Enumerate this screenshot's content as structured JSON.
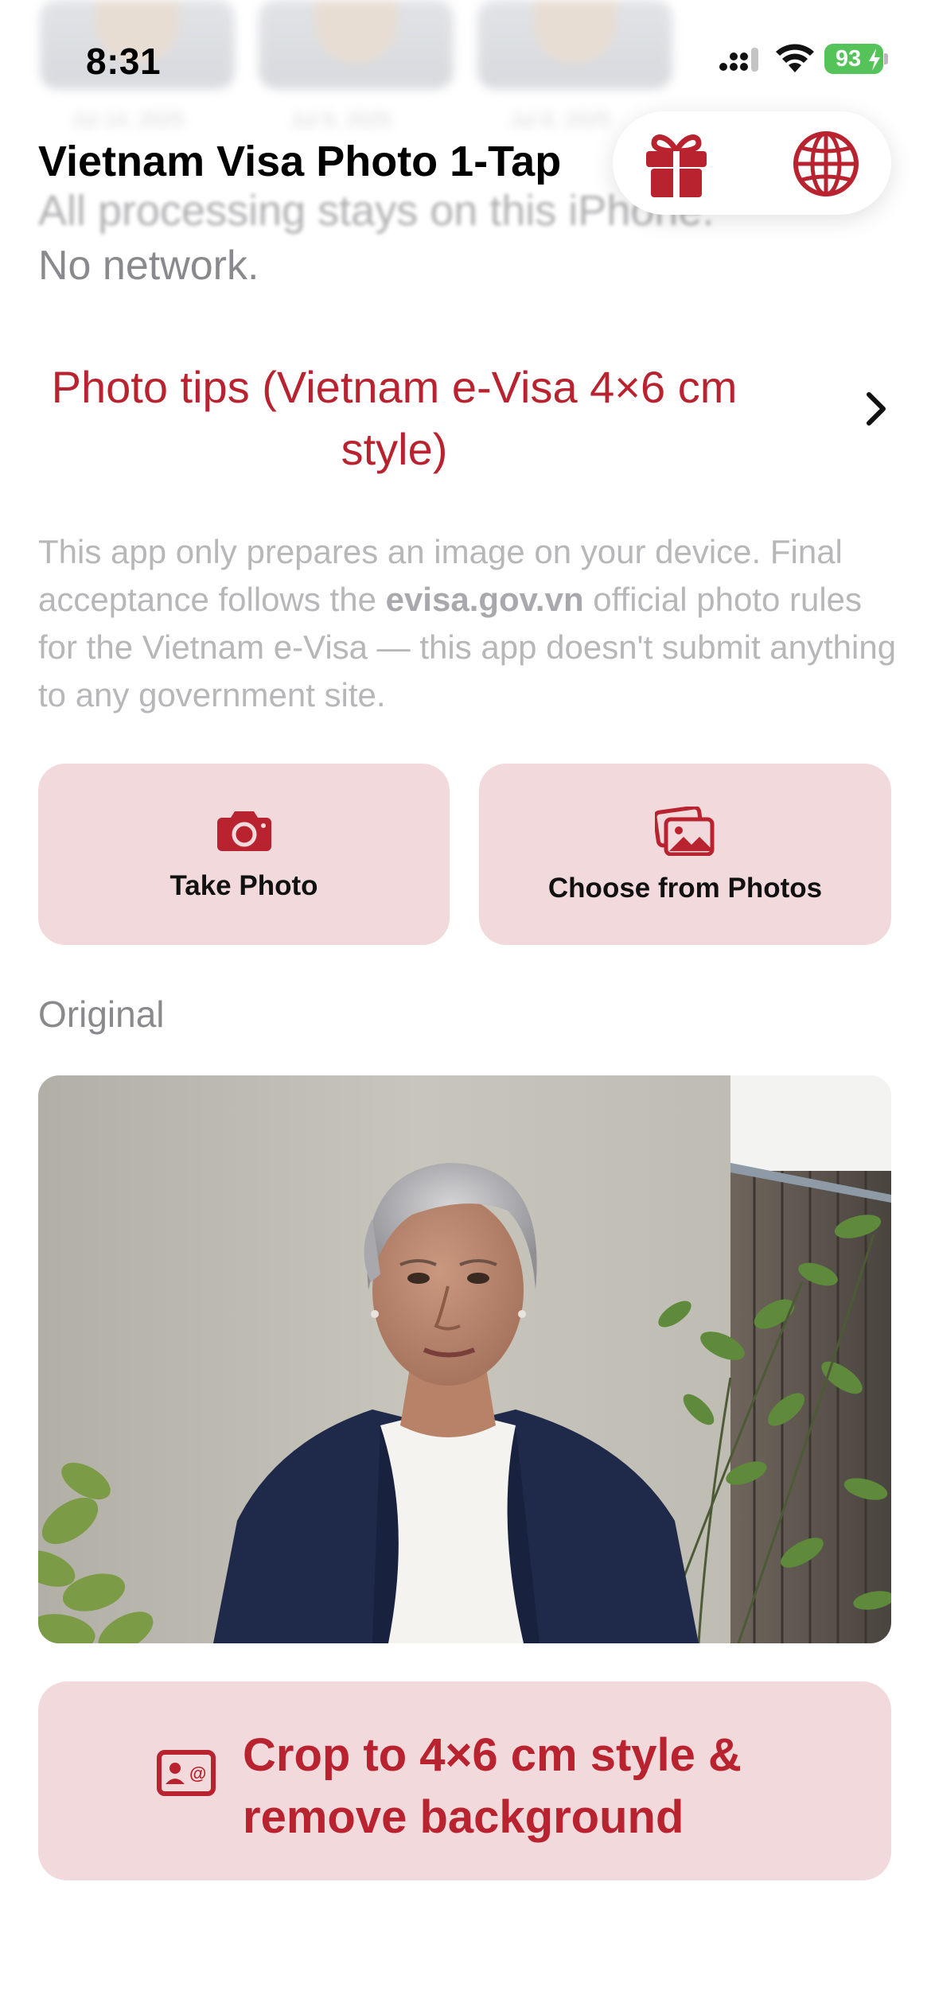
{
  "status_bar": {
    "time": "8:31",
    "battery": "93"
  },
  "history": {
    "dates": [
      "Jul 14, 2025",
      "Jul 9, 2025",
      "Jul 8, 2025"
    ]
  },
  "header": {
    "title": "Vietnam Visa Photo 1-Tap",
    "subtitle_blurred": "All processing stays on this iPhone.",
    "network_status": "No network.",
    "gift_icon": "gift-icon",
    "globe_icon": "globe-icon"
  },
  "tips": {
    "label": "Photo tips (Vietnam e-Visa 4×6 cm style)",
    "chevron_icon": "chevron-right-icon"
  },
  "disclaimer": {
    "before": "This app only prepares an image on your device. Final acceptance follows the ",
    "domain": "evisa.gov.vn",
    "after": " official photo rules for the Vietnam e-Visa — this app doesn't submit anything to any government site."
  },
  "actions": {
    "take_photo": "Take Photo",
    "choose_photos": "Choose from Photos",
    "camera_icon": "camera-icon",
    "photos_icon": "photo-library-icon"
  },
  "original": {
    "section_label": "Original",
    "photo_alt": "Original portrait photo"
  },
  "crop": {
    "label": "Crop to 4×6 cm style & remove background",
    "icon": "id-card-icon"
  },
  "colors": {
    "accent": "#b8232f",
    "button_background": "#f2d9dc",
    "battery": "#54c35a",
    "secondary_text": "#8a8a8e"
  }
}
